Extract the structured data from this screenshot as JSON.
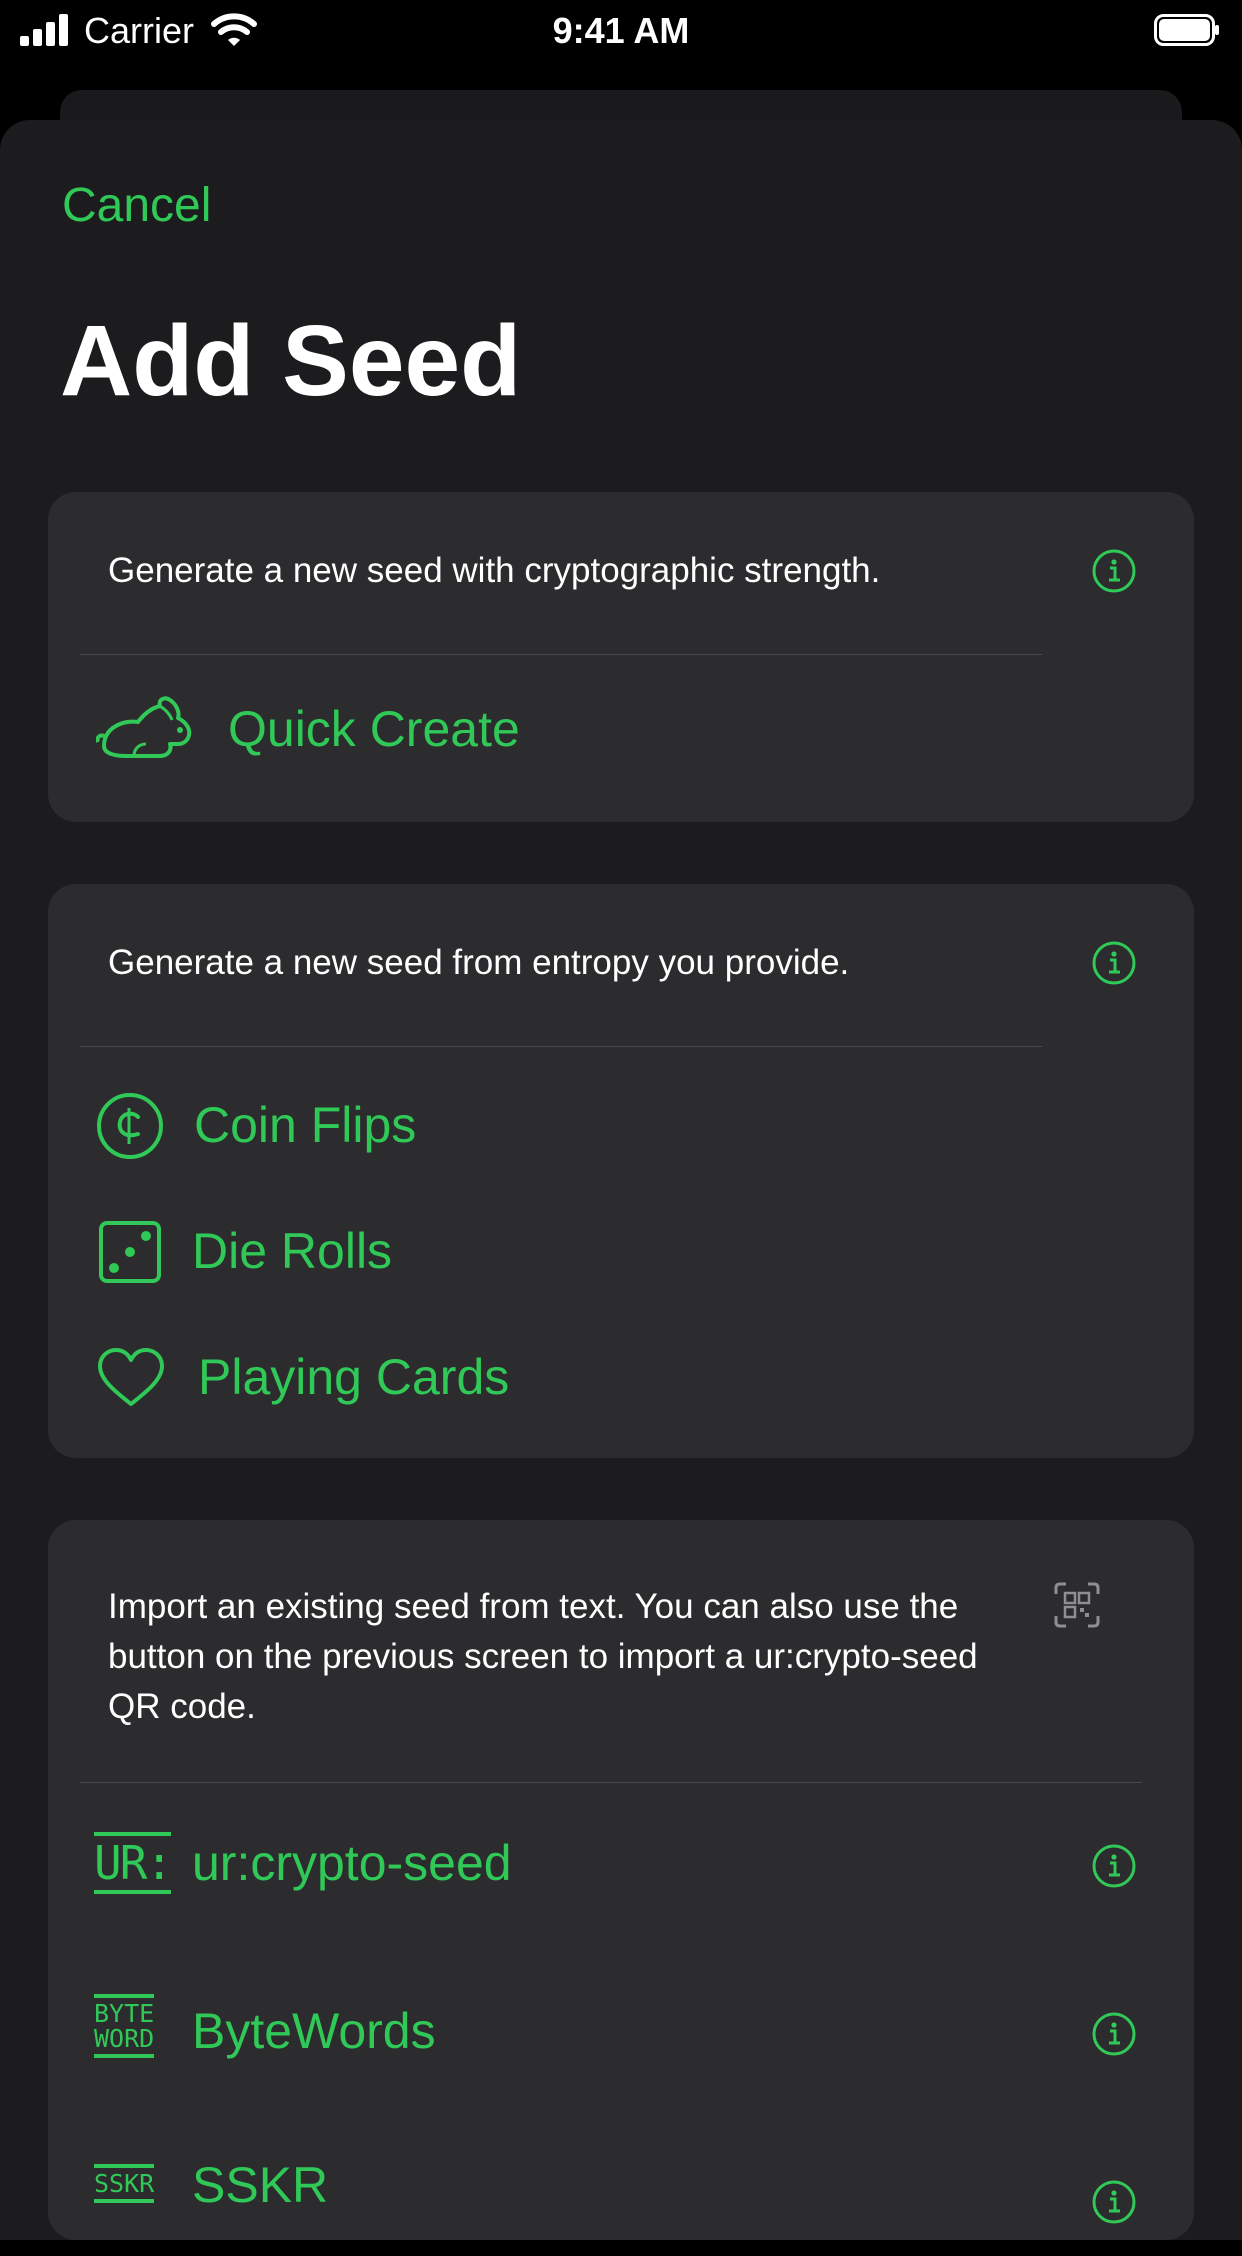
{
  "status_bar": {
    "carrier": "Carrier",
    "time": "9:41 AM"
  },
  "sheet": {
    "cancel_label": "Cancel",
    "title": "Add Seed"
  },
  "colors": {
    "accent": "#30c958",
    "background": "#1c1c1e",
    "card": "#2c2c2e"
  },
  "sections": [
    {
      "description": "Generate a new seed with cryptographic strength.",
      "items": [
        {
          "label": "Quick Create",
          "icon": "rabbit-icon"
        }
      ]
    },
    {
      "description": "Generate a new seed from entropy you provide.",
      "items": [
        {
          "label": "Coin Flips",
          "icon": "coin-icon"
        },
        {
          "label": "Die Rolls",
          "icon": "die-icon"
        },
        {
          "label": "Playing Cards",
          "icon": "heart-icon"
        }
      ]
    },
    {
      "description_line1": "Import an existing seed from text. You can also use the",
      "description_line2": "button on the previous screen to import a ur:crypto-seed",
      "description_line3": "QR code.",
      "items": [
        {
          "label": "ur:crypto-seed",
          "icon": "ur-icon",
          "glyph": "UR:"
        },
        {
          "label": "ByteWords",
          "icon": "bytewords-icon",
          "glyph_top": "BYTE",
          "glyph_bottom": "WORD"
        },
        {
          "label": "SSKR",
          "icon": "sskr-icon",
          "glyph": "SSKR"
        }
      ]
    }
  ]
}
